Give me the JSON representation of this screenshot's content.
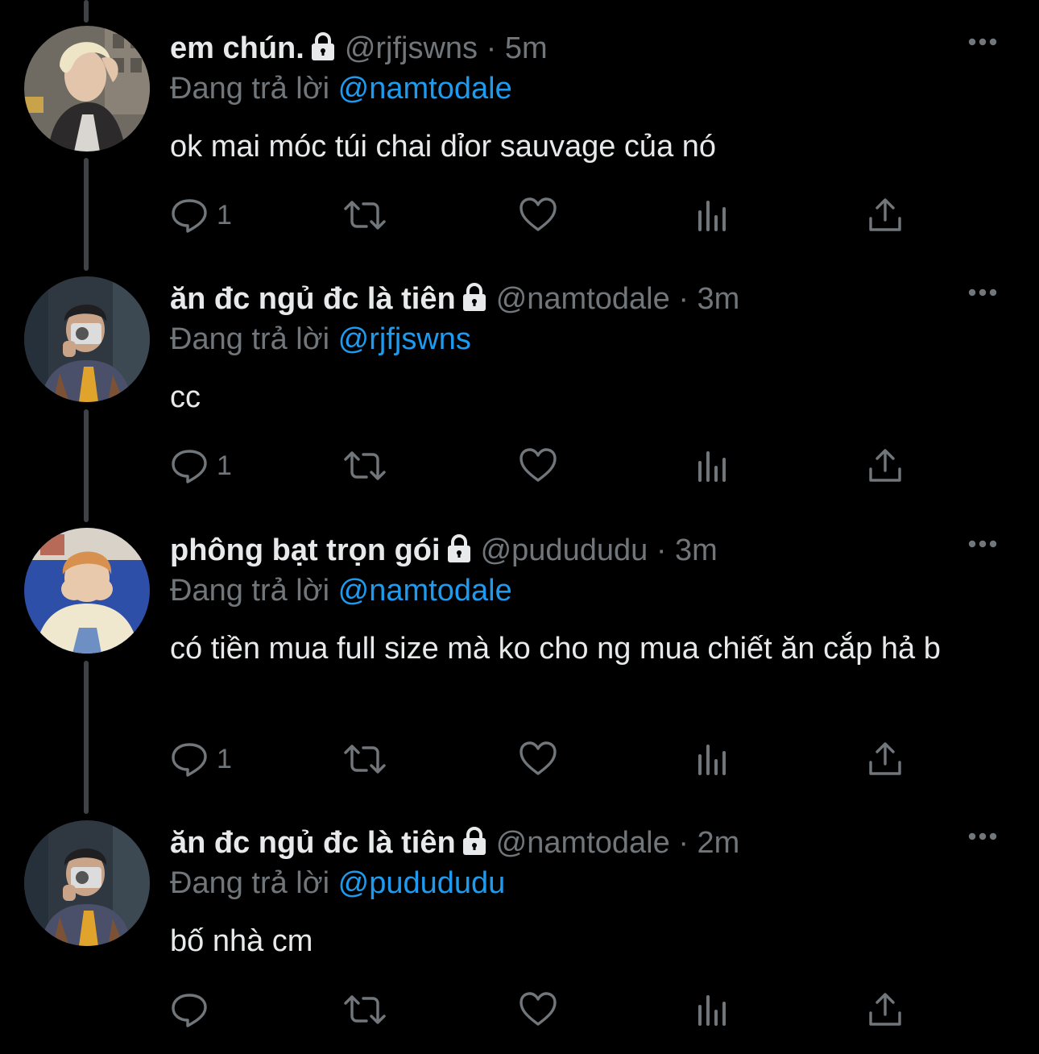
{
  "colors": {
    "background": "#000000",
    "primary_text": "#e7e9ea",
    "secondary_text": "#71767b",
    "link": "#1d9bf0",
    "thread_line": "#3f4348"
  },
  "icons": {
    "lock": "lock-icon",
    "more": "more-icon",
    "reply": "reply-icon",
    "retweet": "retweet-icon",
    "like": "heart-icon",
    "analytics": "analytics-icon",
    "share": "share-icon"
  },
  "tweets": [
    {
      "display_name": "em chún.",
      "handle": "@rjfjswns",
      "separator": "·",
      "time": "5m",
      "reply_prefix": "Đang trả lời",
      "reply_to": "@namtodale",
      "text": "ok mai móc túi chai dỉor sauvage của nó",
      "reply_count": "1"
    },
    {
      "display_name": "ăn đc ngủ đc là tiên",
      "handle": "@namtodale",
      "separator": "·",
      "time": "3m",
      "reply_prefix": "Đang trả lời",
      "reply_to": "@rjfjswns",
      "text": "cc",
      "reply_count": "1"
    },
    {
      "display_name": "phông bạt trọn gói",
      "handle": "@pudududu",
      "separator": "·",
      "time": "3m",
      "reply_prefix": "Đang trả lời",
      "reply_to": "@namtodale",
      "text": "có tiền mua full size mà ko cho ng mua chiết ăn cắp hả b",
      "reply_count": "1"
    },
    {
      "display_name": "ăn đc ngủ đc là tiên",
      "handle": "@namtodale",
      "separator": "·",
      "time": "2m",
      "reply_prefix": "Đang trả lời",
      "reply_to": "@pudududu",
      "text": "bố nhà cm",
      "reply_count": ""
    }
  ]
}
